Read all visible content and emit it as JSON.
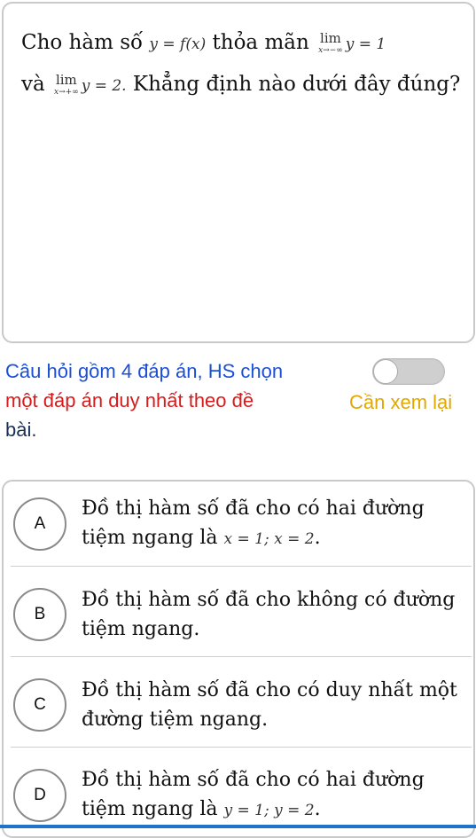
{
  "question": {
    "part1": "Cho hàm số ",
    "func": "y = f(x)",
    "part2": " thỏa mãn ",
    "lim1_word": "lim",
    "lim1_sub": "x→−∞",
    "lim1_expr": "y = 1",
    "part3": "và ",
    "lim2_word": "lim",
    "lim2_sub": "x→+∞",
    "lim2_expr": "y = 2.",
    "part4": " Khẳng định nào dưới đây đúng?"
  },
  "instruction": {
    "blue1": "Câu hỏi gồm 4 đáp án, HS chọn",
    "red": "một đáp án duy nhất theo đề",
    "dark": "bài."
  },
  "review_label": "Cần xem lại",
  "review_toggle_on": false,
  "options": [
    {
      "letter": "A",
      "text": "Đồ thị hàm số đã cho có hai đường tiệm ngang là ",
      "math": "x = 1; x = 2",
      "tail": "."
    },
    {
      "letter": "B",
      "text": "Đồ thị hàm số đã cho không có đường tiệm ngang.",
      "math": "",
      "tail": ""
    },
    {
      "letter": "C",
      "text": "Đồ thị hàm số đã cho có duy nhất một đường tiệm ngang.",
      "math": "",
      "tail": ""
    },
    {
      "letter": "D",
      "text": "Đồ thị hàm số đã cho có hai đường tiệm ngang là ",
      "math": "y = 1; y = 2",
      "tail": "."
    }
  ],
  "colors": {
    "instruction_blue": "#1a4fd6",
    "instruction_red": "#d61c1c",
    "review_yellow": "#e0a800",
    "bar_blue": "#1f73c8"
  }
}
